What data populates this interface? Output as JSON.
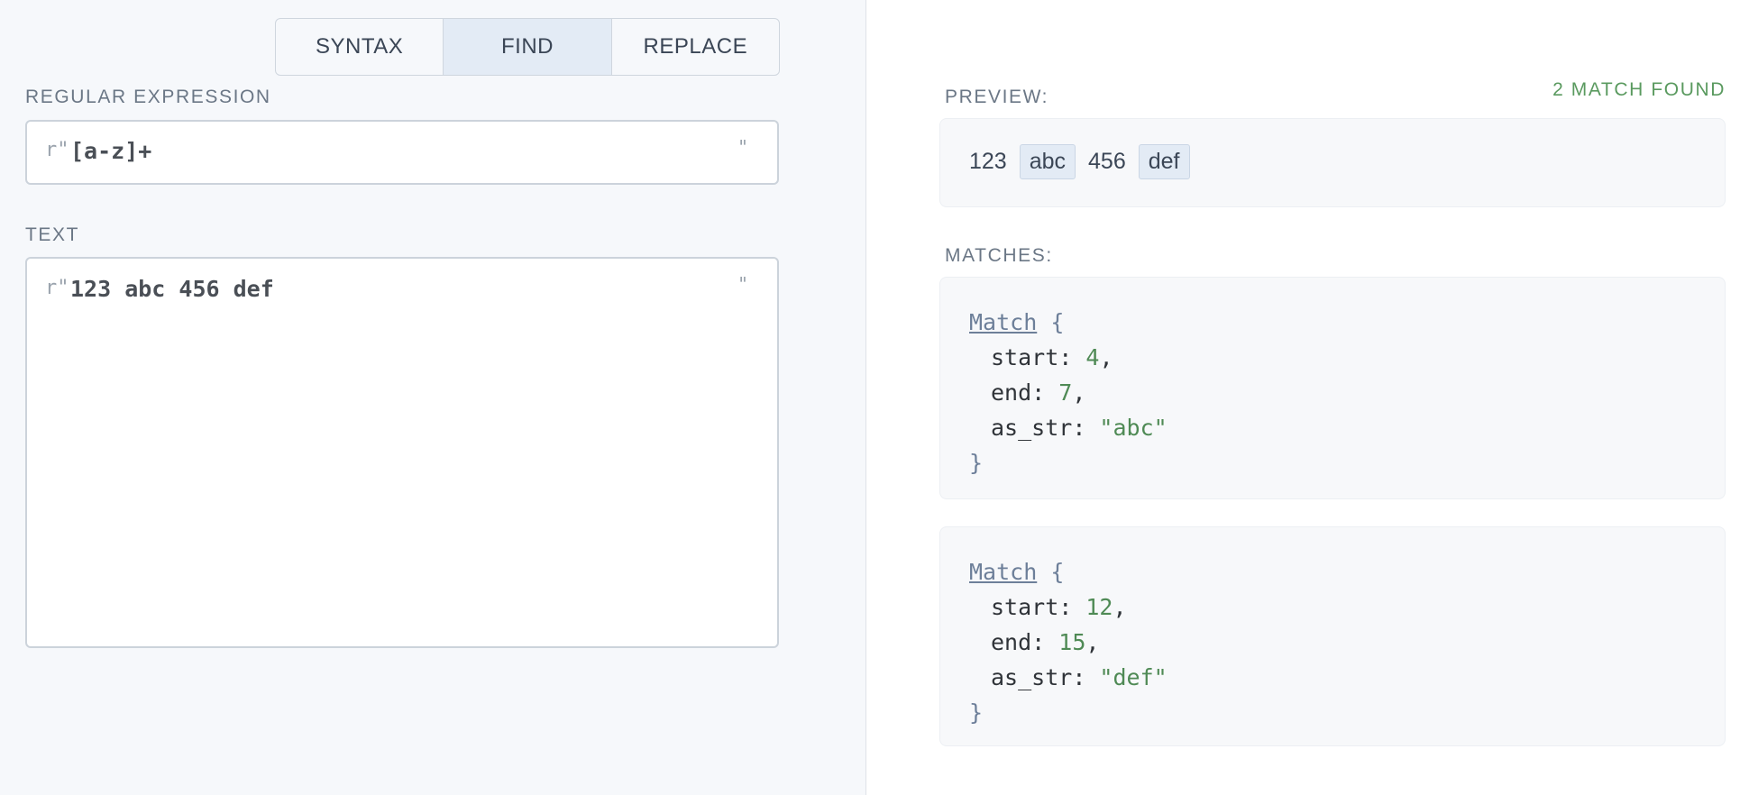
{
  "tabs": [
    {
      "label": "SYNTAX",
      "active": false
    },
    {
      "label": "FIND",
      "active": true
    },
    {
      "label": "REPLACE",
      "active": false
    }
  ],
  "regex": {
    "label": "REGULAR EXPRESSION",
    "prefix": "r\"",
    "value": "[a-z]+",
    "suffix": "\""
  },
  "text": {
    "label": "TEXT",
    "prefix": "r\"",
    "value": "123 abc 456 def",
    "suffix": "\""
  },
  "preview": {
    "label": "PREVIEW:",
    "match_count": "2 MATCH FOUND",
    "tokens": [
      "123",
      "abc",
      "456",
      "def"
    ]
  },
  "matches": {
    "label": "MATCHES:",
    "keyword": "Match",
    "items": [
      {
        "start": "4",
        "end": "7",
        "as_str": "\"abc\""
      },
      {
        "start": "12",
        "end": "15",
        "as_str": "\"def\""
      }
    ],
    "field_names": {
      "start": "start",
      "end": "end",
      "as_str": "as_str"
    }
  },
  "colors": {
    "accent_green": "#5a9a5f",
    "highlight": "#e3ebf5",
    "muted": "#6b7786"
  }
}
